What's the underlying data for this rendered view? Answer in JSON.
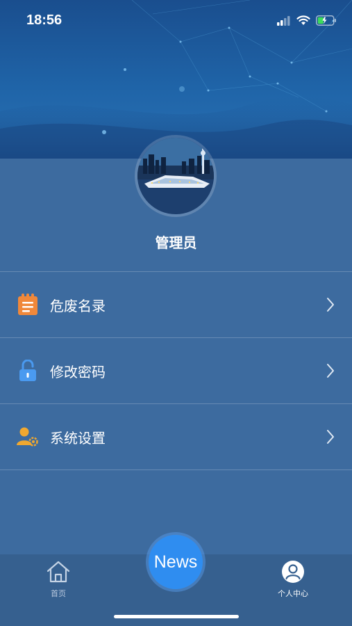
{
  "status_bar": {
    "time": "18:56"
  },
  "profile": {
    "username": "管理员"
  },
  "menu": {
    "items": [
      {
        "label": "危废名录",
        "icon": "clipboard-icon",
        "icon_color": "#f0883a"
      },
      {
        "label": "修改密码",
        "icon": "unlock-icon",
        "icon_color": "#4a9af0"
      },
      {
        "label": "系统设置",
        "icon": "user-settings-icon",
        "icon_color": "#f0a830"
      }
    ]
  },
  "news_button": {
    "label": "News"
  },
  "tabbar": {
    "home_label": "首页",
    "profile_label": "个人中心"
  },
  "colors": {
    "background": "#3d6b9f",
    "header": "#1f64a8",
    "news_button": "#2f8df0",
    "tabbar": "#36608f"
  }
}
